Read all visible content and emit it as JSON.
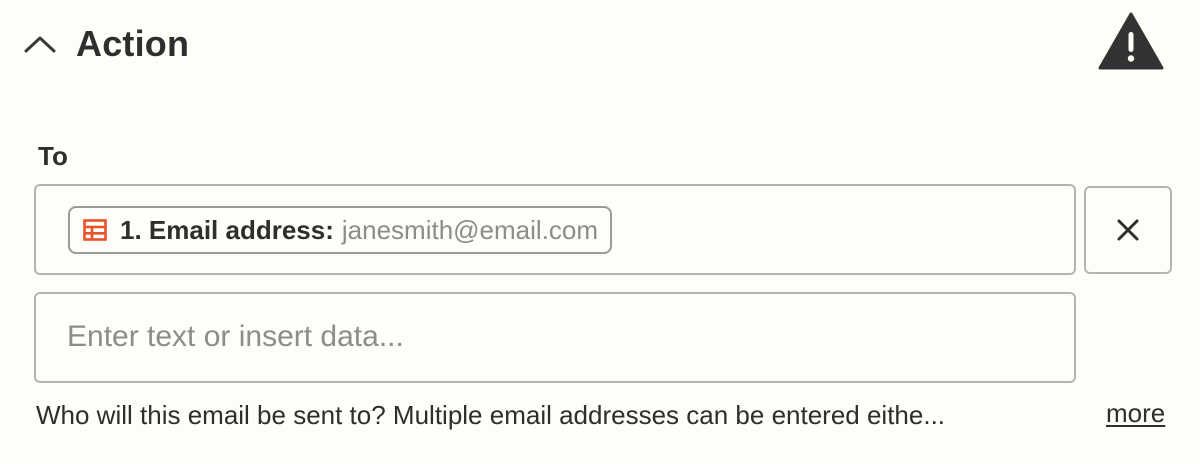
{
  "section": {
    "title": "Action",
    "collapse_icon": "chevron-up-icon",
    "status_icon": "warning-triangle-icon",
    "warning_color": "#333333"
  },
  "field": {
    "label": "To",
    "mapped_values": [
      {
        "icon": "table-icon",
        "icon_color": "#e8532b",
        "label": "1. Email address:",
        "value": "janesmith@email.com"
      }
    ],
    "clear_icon": "close-icon",
    "input_placeholder": "Enter text or insert data...",
    "help_text": "Who will this email be sent to? Multiple email addresses can be entered eithe...",
    "more_link": "more"
  }
}
